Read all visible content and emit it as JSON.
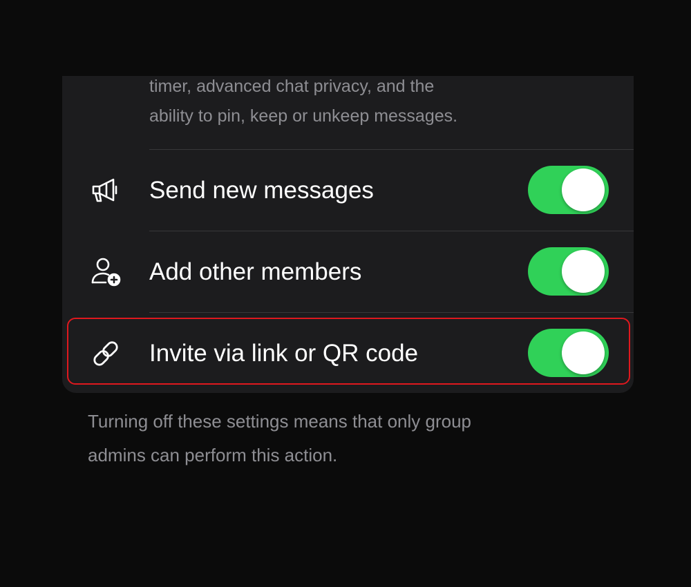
{
  "description": {
    "line1": "timer, advanced chat privacy, and the",
    "line2": "ability to pin, keep or unkeep messages."
  },
  "settings": [
    {
      "label": "Send new messages",
      "icon": "megaphone-icon",
      "enabled": true
    },
    {
      "label": "Add other members",
      "icon": "add-person-icon",
      "enabled": true
    },
    {
      "label": "Invite via link or QR code",
      "icon": "link-icon",
      "enabled": true
    }
  ],
  "footer": {
    "line1": "Turning off these settings means that only group",
    "line2": "admins can perform this action."
  },
  "colors": {
    "toggle_on": "#30d158",
    "highlight": "#e0181e",
    "card": "#1c1c1e",
    "secondary_text": "#8e8e93"
  }
}
